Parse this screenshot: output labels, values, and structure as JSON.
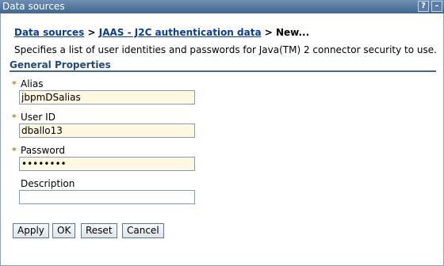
{
  "window": {
    "title": "Data sources",
    "help_icon": "help-icon",
    "minimize_icon": "minimize-icon"
  },
  "breadcrumb": {
    "link1": "Data sources",
    "sep1": " > ",
    "link2": "JAAS - J2C authentication data",
    "sep2": " > ",
    "current": "New..."
  },
  "description": "Specifies a list of user identities and passwords for Java(TM) 2 connector security to use.",
  "section": {
    "title": "General Properties"
  },
  "fields": {
    "alias": {
      "label": "Alias",
      "value": "jbpmDSalias",
      "required": true
    },
    "userid": {
      "label": "User ID",
      "value": "dballo13",
      "required": true
    },
    "password": {
      "label": "Password",
      "value": "••••••••",
      "required": true
    },
    "description": {
      "label": "Description",
      "value": "",
      "required": false
    }
  },
  "required_marker": "*",
  "buttons": {
    "apply": "Apply",
    "ok": "OK",
    "reset": "Reset",
    "cancel": "Cancel"
  },
  "colors": {
    "titlebar": "#3f6790",
    "link": "#0b3d91",
    "required_field_bg": "#fff8e1",
    "section_rule": "#3f6790"
  }
}
